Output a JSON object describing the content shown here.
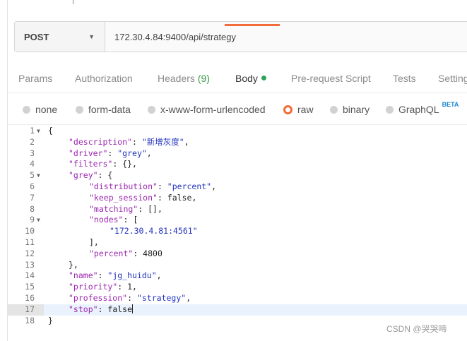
{
  "request": {
    "method": "POST",
    "url": "172.30.4.84:9400/api/strategy"
  },
  "tabs": [
    {
      "label": "Params"
    },
    {
      "label": "Authorization"
    },
    {
      "label": "Headers",
      "count": "(9)"
    },
    {
      "label": "Body"
    },
    {
      "label": "Pre-request Script"
    },
    {
      "label": "Tests"
    },
    {
      "label": "Setting"
    }
  ],
  "body_types": [
    {
      "label": "none",
      "selected": false
    },
    {
      "label": "form-data",
      "selected": false
    },
    {
      "label": "x-www-form-urlencoded",
      "selected": false
    },
    {
      "label": "raw",
      "selected": true
    },
    {
      "label": "binary",
      "selected": false
    },
    {
      "label": "GraphQL",
      "badge": "BETA",
      "selected": false
    }
  ],
  "editor": {
    "current_line": 17,
    "lines": [
      {
        "n": "1",
        "fold": true,
        "text": "{"
      },
      {
        "n": "2",
        "key": "\"description\"",
        "sep": ": ",
        "val": "\"新增灰度\"",
        "tail": ","
      },
      {
        "n": "3",
        "key": "\"driver\"",
        "sep": ": ",
        "val": "\"grey\"",
        "tail": ","
      },
      {
        "n": "4",
        "key": "\"filters\"",
        "sep": ": ",
        "plain": "{},"
      },
      {
        "n": "5",
        "fold": true,
        "key": "\"grey\"",
        "sep": ": ",
        "plain": "{"
      },
      {
        "n": "6",
        "key": "\"distribution\"",
        "sep": ": ",
        "val": "\"percent\"",
        "tail": ","
      },
      {
        "n": "7",
        "key": "\"keep_session\"",
        "sep": ": ",
        "plain": "false,"
      },
      {
        "n": "8",
        "key": "\"matching\"",
        "sep": ": ",
        "plain": "[],"
      },
      {
        "n": "9",
        "fold": true,
        "key": "\"nodes\"",
        "sep": ": ",
        "plain": "["
      },
      {
        "n": "10",
        "val": "\"172.30.4.81:4561\""
      },
      {
        "n": "11",
        "plain": "],"
      },
      {
        "n": "12",
        "key": "\"percent\"",
        "sep": ": ",
        "plain": "4800"
      },
      {
        "n": "13",
        "plain": "},"
      },
      {
        "n": "14",
        "key": "\"name\"",
        "sep": ": ",
        "val": "\"jg_huidu\"",
        "tail": ","
      },
      {
        "n": "15",
        "key": "\"priority\"",
        "sep": ": ",
        "plain": "1,"
      },
      {
        "n": "16",
        "key": "\"profession\"",
        "sep": ": ",
        "val": "\"strategy\"",
        "tail": ","
      },
      {
        "n": "17",
        "key": "\"stop\"",
        "sep": ": ",
        "plain": "false"
      },
      {
        "n": "18",
        "text": "}"
      }
    ]
  },
  "watermark": "CSDN @哭哭啼"
}
